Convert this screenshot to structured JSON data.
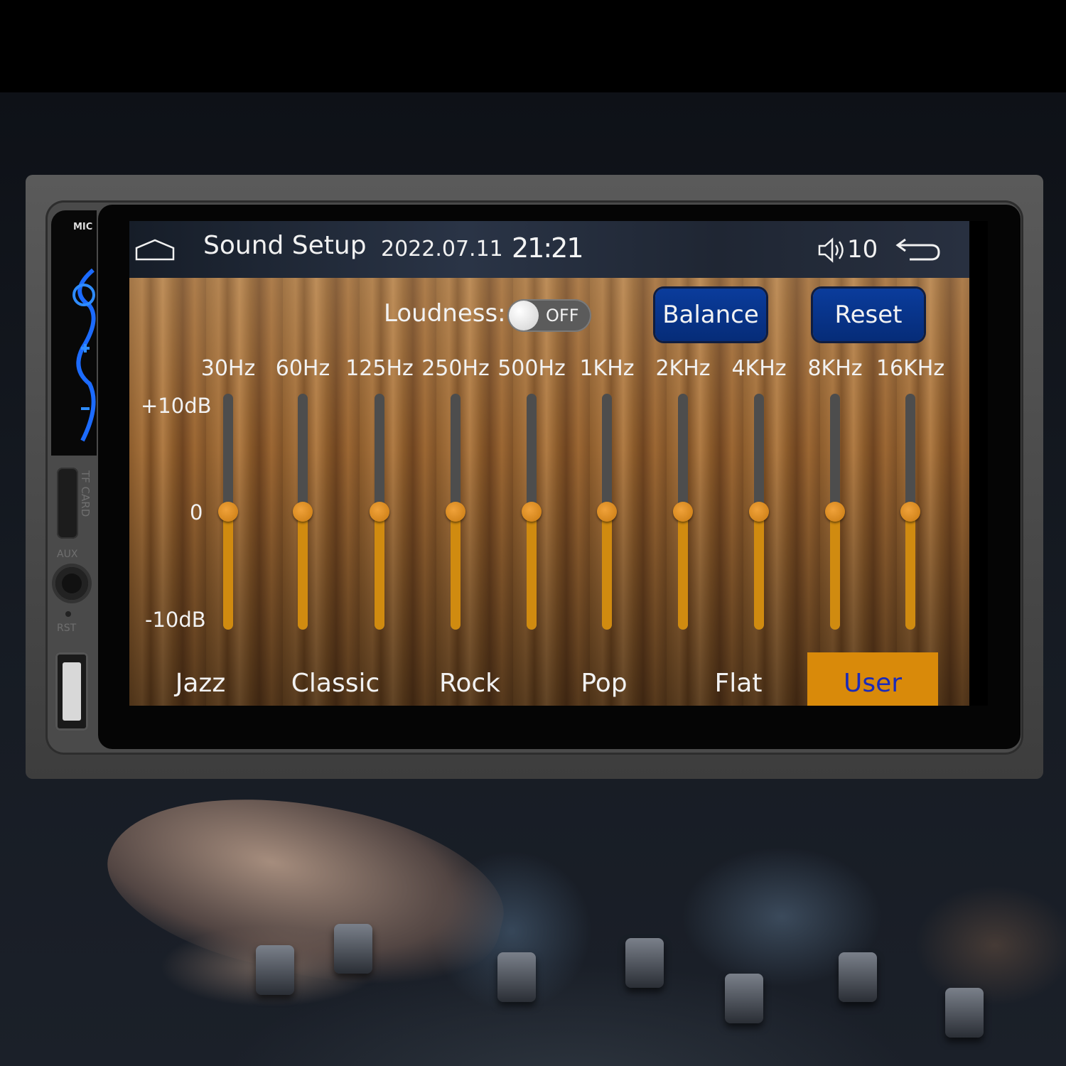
{
  "device": {
    "mic_label": "MIC",
    "tf_label": "TF CARD",
    "aux_label": "AUX",
    "rst_label": "RST"
  },
  "status_bar": {
    "title": "Sound Setup",
    "date": "2022.07.11",
    "time": "21:21",
    "volume": "10"
  },
  "controls": {
    "loudness_label": "Loudness:",
    "loudness_state": "OFF",
    "balance_label": "Balance",
    "reset_label": "Reset"
  },
  "equalizer": {
    "db_max": "+10dB",
    "db_zero": "0",
    "db_min": "-10dB",
    "bands": [
      {
        "label": "30Hz",
        "value": 0
      },
      {
        "label": "60Hz",
        "value": 0
      },
      {
        "label": "125Hz",
        "value": 0
      },
      {
        "label": "250Hz",
        "value": 0
      },
      {
        "label": "500Hz",
        "value": 0
      },
      {
        "label": "1KHz",
        "value": 0
      },
      {
        "label": "2KHz",
        "value": 0
      },
      {
        "label": "4KHz",
        "value": 0
      },
      {
        "label": "8KHz",
        "value": 0
      },
      {
        "label": "16KHz",
        "value": 0
      }
    ]
  },
  "presets": {
    "items": [
      "Jazz",
      "Classic",
      "Rock",
      "Pop",
      "Flat",
      "User"
    ],
    "selected": "User"
  },
  "colors": {
    "accent": "#d98a0a",
    "button_blue": "#0a3c9c",
    "selected_text": "#1b2bb8"
  }
}
